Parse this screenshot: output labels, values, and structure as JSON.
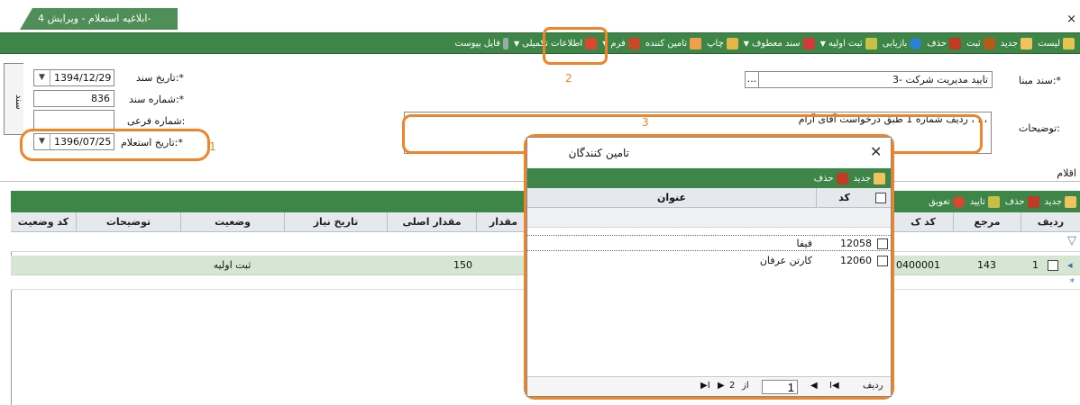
{
  "tab": {
    "title": "ابلاغیه استعلام - ویرایش 4-"
  },
  "toolbar": {
    "items": [
      {
        "label": "لیست",
        "icon": "list-icon"
      },
      {
        "label": "جدید",
        "icon": "new-icon"
      },
      {
        "label": "ثبت",
        "icon": "save-icon"
      },
      {
        "label": "حذف",
        "icon": "delete-icon"
      },
      {
        "label": "بازیابی",
        "icon": "refresh-icon"
      },
      {
        "label": "ثبت اولیه",
        "icon": "status-icon"
      },
      {
        "label": "سند معطوف",
        "icon": "linked-document-icon"
      },
      {
        "label": "چاپ",
        "icon": "print-icon"
      },
      {
        "label": "تامین کننده",
        "icon": "supplier-icon"
      },
      {
        "label": "فرم",
        "icon": "form-icon"
      },
      {
        "label": "اطلاعات تکمیلی",
        "icon": "info-icon"
      },
      {
        "label": "فایل پیوست",
        "icon": "attachment-icon"
      }
    ]
  },
  "annotations": {
    "n1": "1",
    "n2": "2",
    "n3": "3"
  },
  "form": {
    "doc_date_label": "تاریخ سند:*",
    "doc_date_value": "1394/12/29",
    "doc_number_label": "شماره سند:*",
    "doc_number_value": "836",
    "sub_number_label": "شماره فرعی:",
    "sub_number_value": "",
    "inquiry_date_label": "تاریخ استعلام:*",
    "inquiry_date_value": "1396/07/25",
    "base_doc_label": "سند مبنا:*",
    "base_doc_value": "3- تایید مدیریت شرکت",
    "base_doc_button": "...",
    "description_label": "توضیحات:",
    "description_value": "ردیف شماره 1 طبق درخواست آقای آرام ، ، ،",
    "side_tab_label": "سند"
  },
  "items_section": {
    "label": "اقلام"
  },
  "grid_toolbar": {
    "items": [
      {
        "label": "جدید",
        "icon": "new-icon"
      },
      {
        "label": "حذف",
        "icon": "delete-icon"
      },
      {
        "label": "تایید",
        "icon": "approve-icon"
      },
      {
        "label": "تعویق",
        "icon": "clock-icon"
      }
    ]
  },
  "grid": {
    "headers": [
      "ردیف",
      "مرجع",
      "کد ک",
      "مقدار",
      "مقدار اصلی",
      "تاریخ نیاز",
      "وضعیت",
      "توضیحات",
      "کد وضعیت"
    ],
    "row": {
      "index": "1",
      "ref": "143",
      "code": "0400001",
      "orig_qty": "150",
      "status": "ثبت اولیه"
    },
    "new_row_marker": "*"
  },
  "dialog": {
    "title": "تامین کنندگان",
    "close": "✕",
    "toolbar": [
      {
        "label": "جدید",
        "icon": "new-icon"
      },
      {
        "label": "حذف",
        "icon": "delete-icon"
      }
    ],
    "headers": {
      "code": "کد",
      "title": "عنوان"
    },
    "rows": [
      {
        "code": "12058",
        "title": "فیفا"
      },
      {
        "code": "12060",
        "title": "کارتن عرفان"
      }
    ],
    "pager": {
      "row_label": "ردیف",
      "page": "1",
      "of_label": "از",
      "total": "2"
    }
  }
}
